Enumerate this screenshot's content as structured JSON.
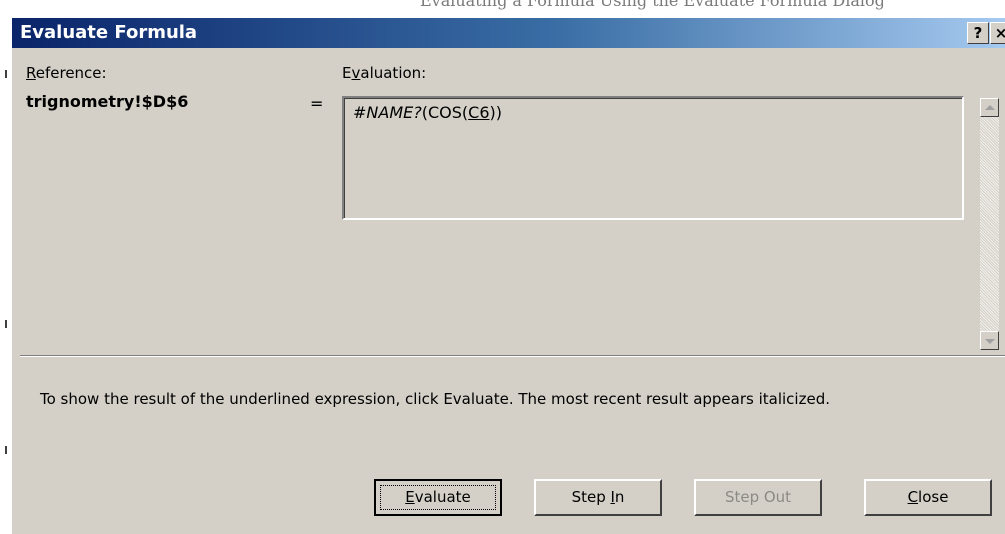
{
  "top_strip": {
    "ghost_text": "Evaluating a Formula Using the Evaluate Formula Dialog"
  },
  "dialog": {
    "title": "Evaluate Formula",
    "help_glyph": "?",
    "close_glyph": "×"
  },
  "reference": {
    "label_mn": "R",
    "label_rest": "eference:",
    "value": "trignometry!$D$6"
  },
  "evaluation": {
    "label_pre": "E",
    "label_mn": "v",
    "label_rest": "aluation:",
    "equals": "=",
    "formula_result": "#NAME?",
    "formula_pre": "(COS(",
    "formula_underlined": "C6",
    "formula_post": "))"
  },
  "instructions": "To show the result of the underlined expression, click Evaluate.  The most recent result appears italicized.",
  "buttons": {
    "evaluate": {
      "mn": "E",
      "rest": "valuate"
    },
    "step_in": {
      "pre": "Step ",
      "mn": "I",
      "rest": "n"
    },
    "step_out": {
      "label": "Step Out",
      "enabled": false
    },
    "close": {
      "mn": "C",
      "rest": "lose"
    }
  },
  "colors": {
    "titlebar_start": "#0a246a",
    "titlebar_end": "#a6caf0",
    "dialog_face": "#d4d0c8",
    "disabled_text": "#8c8a85"
  }
}
